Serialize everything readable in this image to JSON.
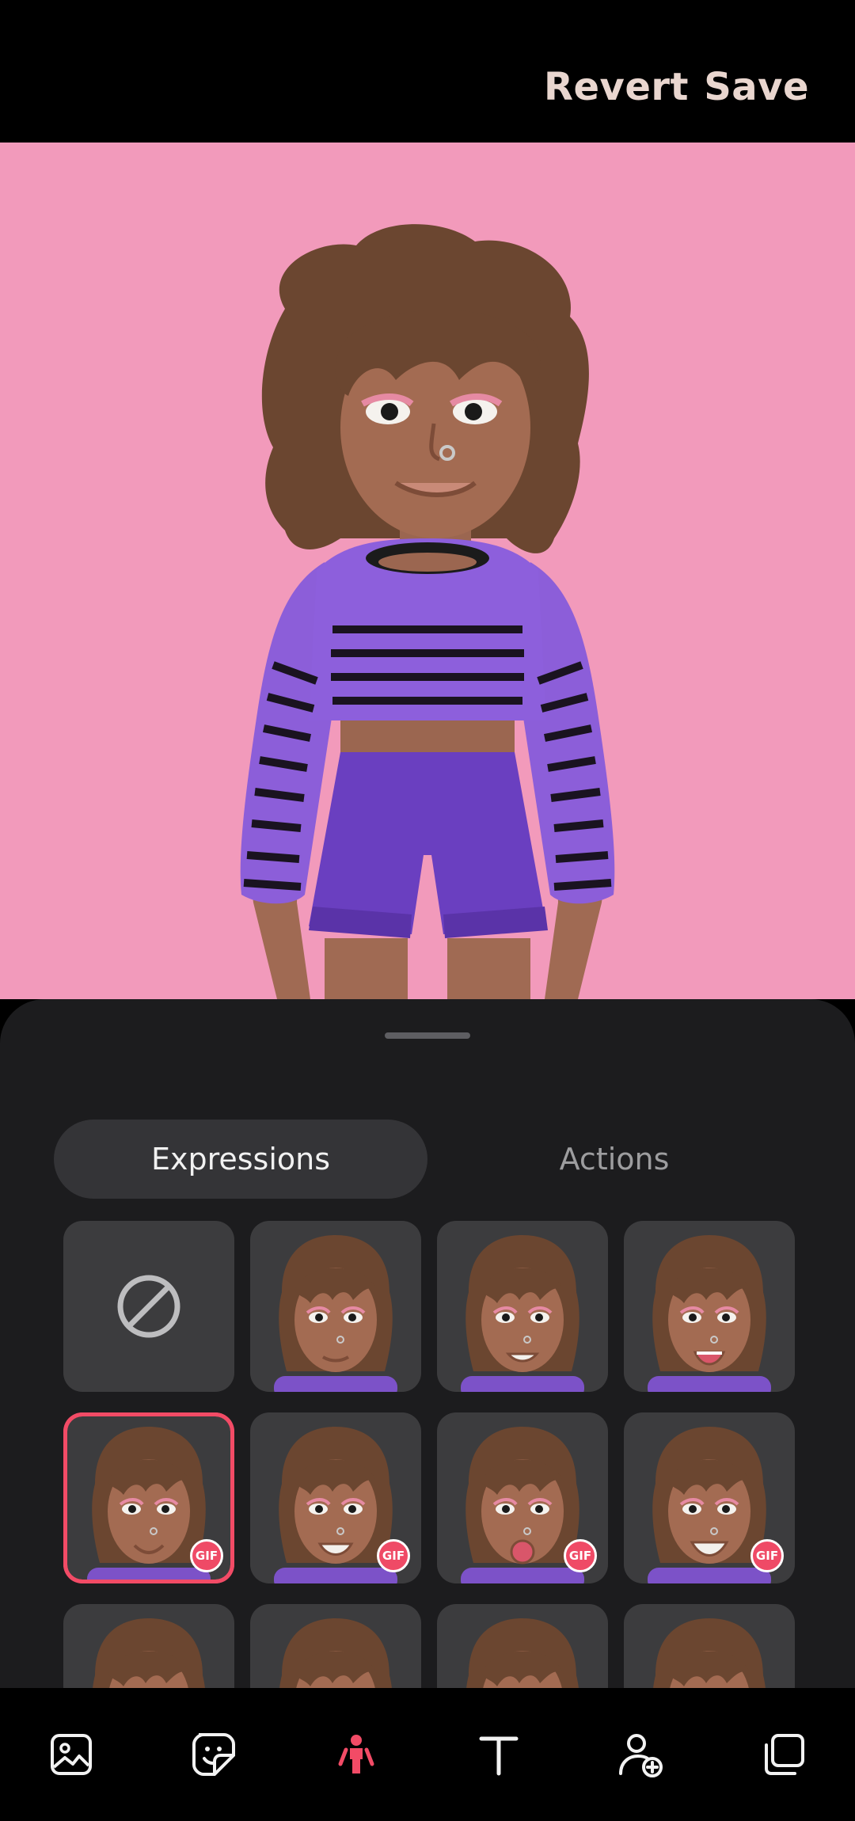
{
  "header": {
    "revert_label": "Revert",
    "save_label": "Save"
  },
  "tabs": [
    {
      "label": "Expressions",
      "active": true
    },
    {
      "label": "Actions",
      "active": false
    }
  ],
  "expressions": {
    "selected_index": 4,
    "items": [
      {
        "type": "none",
        "icon": "no-expression-icon"
      },
      {
        "type": "avatar",
        "mouth": "neutral",
        "gif": false
      },
      {
        "type": "avatar",
        "mouth": "grin",
        "gif": false
      },
      {
        "type": "avatar",
        "mouth": "open-smile",
        "gif": false
      },
      {
        "type": "avatar",
        "mouth": "smile",
        "gif": true,
        "badge": "GIF"
      },
      {
        "type": "avatar",
        "mouth": "big-smile",
        "gif": true,
        "badge": "GIF"
      },
      {
        "type": "avatar",
        "mouth": "open",
        "gif": true,
        "badge": "GIF"
      },
      {
        "type": "avatar",
        "mouth": "laugh",
        "gif": true,
        "badge": "GIF"
      },
      {
        "type": "avatar",
        "mouth": "partial",
        "gif": false
      },
      {
        "type": "avatar",
        "mouth": "partial",
        "gif": false
      },
      {
        "type": "avatar",
        "mouth": "partial",
        "gif": false
      },
      {
        "type": "avatar",
        "mouth": "partial",
        "gif": false
      }
    ]
  },
  "bottom_nav": [
    {
      "icon": "gallery-icon",
      "active": false
    },
    {
      "icon": "sticker-icon",
      "active": false
    },
    {
      "icon": "avatar-pose-icon",
      "active": true
    },
    {
      "icon": "text-icon",
      "active": false
    },
    {
      "icon": "add-person-icon",
      "active": false
    },
    {
      "icon": "layers-icon",
      "active": false
    }
  ],
  "colors": {
    "accent": "#f24b66",
    "preview_background": "#f29abb",
    "sheet_background": "#1c1c1e"
  }
}
